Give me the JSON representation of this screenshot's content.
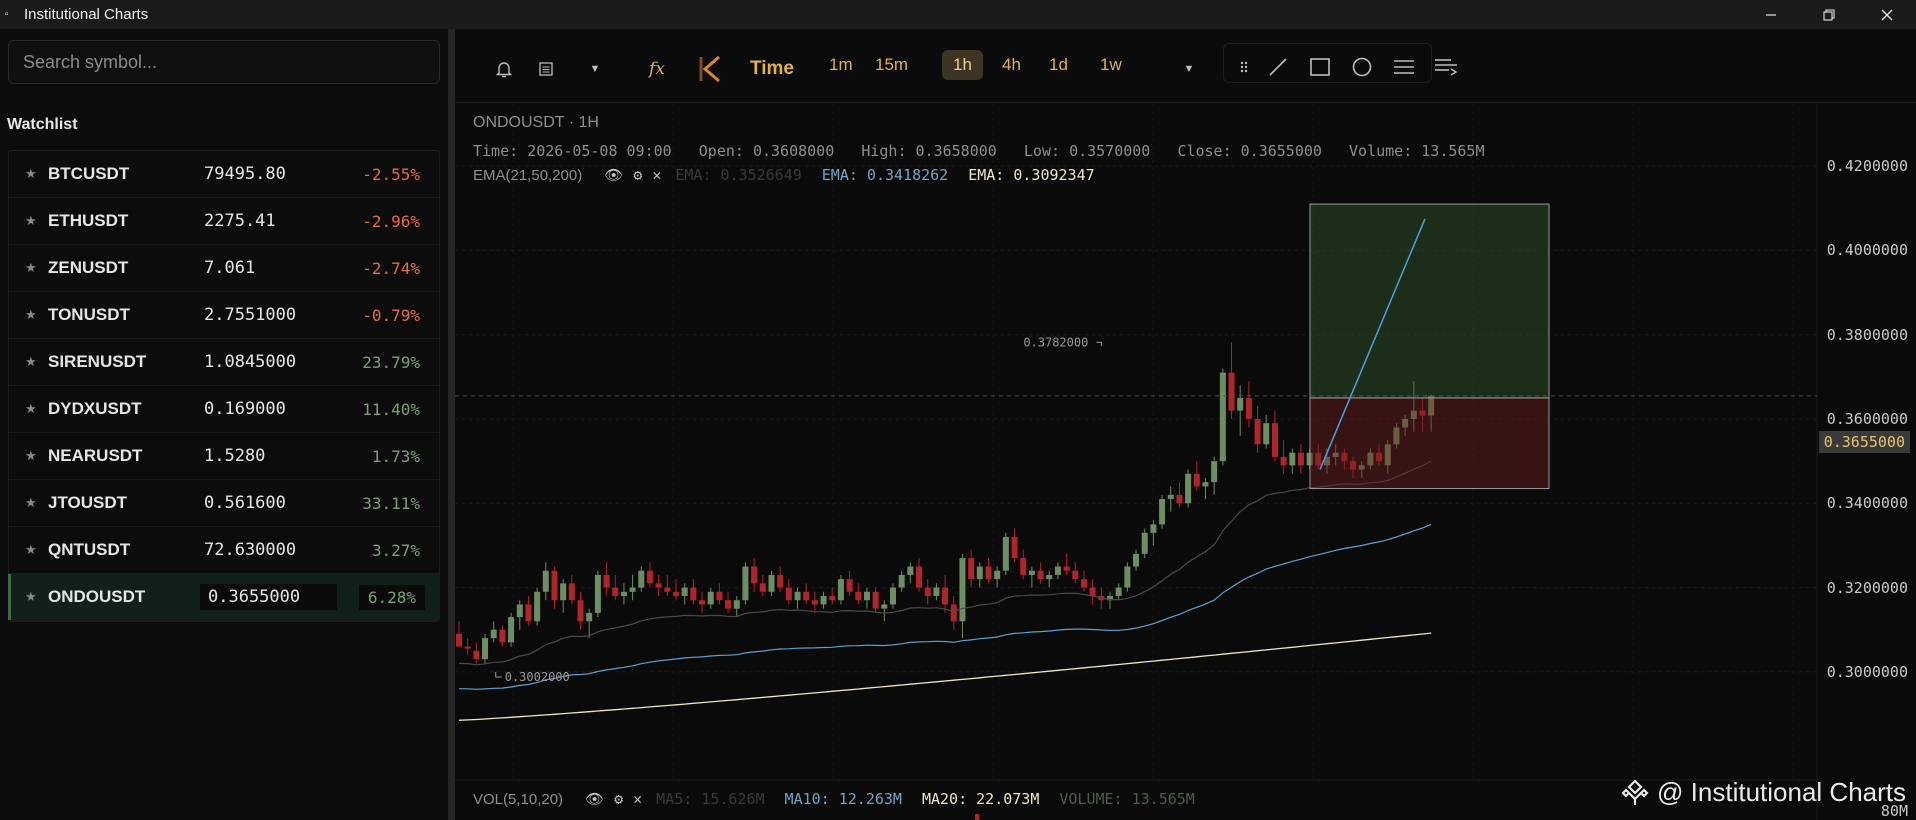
{
  "app": {
    "title": "Institutional Charts",
    "icon": "chart-app-icon",
    "window_controls": [
      "minimize-icon",
      "restore-icon",
      "close-icon"
    ]
  },
  "sidebar": {
    "search_placeholder": "Search symbol...",
    "watchlist_title": "Watchlist",
    "items": [
      {
        "symbol": "BTCUSDT",
        "price": "79495.80",
        "change": "-2.55%",
        "dir": "neg"
      },
      {
        "symbol": "ETHUSDT",
        "price": "2275.41",
        "change": "-2.96%",
        "dir": "neg"
      },
      {
        "symbol": "ZENUSDT",
        "price": "7.061",
        "change": "-2.74%",
        "dir": "neg"
      },
      {
        "symbol": "TONUSDT",
        "price": "2.7551000",
        "change": "-0.79%",
        "dir": "neg"
      },
      {
        "symbol": "SIRENUSDT",
        "price": "1.0845000",
        "change": "23.79%",
        "dir": "pos"
      },
      {
        "symbol": "DYDXUSDT",
        "price": "0.169000",
        "change": "11.40%",
        "dir": "pos"
      },
      {
        "symbol": "NEARUSDT",
        "price": "1.5280",
        "change": "1.73%",
        "dir": "pos"
      },
      {
        "symbol": "JTOUSDT",
        "price": "0.561600",
        "change": "33.11%",
        "dir": "pos"
      },
      {
        "symbol": "QNTUSDT",
        "price": "72.630000",
        "change": "3.27%",
        "dir": "pos"
      },
      {
        "symbol": "ONDOUSDT",
        "price": "0.3655000",
        "change": "6.28%",
        "dir": "pos",
        "active": true
      }
    ]
  },
  "toolbar": {
    "fx_label": "fx",
    "time_label": "Time",
    "timeframes": [
      "1m",
      "15m",
      "1h",
      "4h",
      "1d",
      "1w"
    ],
    "selected_timeframe": "1h",
    "tools": [
      "drag-handle-icon",
      "trend-line-icon",
      "rectangle-icon",
      "circle-icon",
      "parallel-lines-icon",
      "text-lines-icon"
    ]
  },
  "legend": {
    "title": "ONDOUSDT · 1H",
    "time_label": "Time:",
    "time": "2026-05-08 09:00",
    "open_label": "Open:",
    "open": "0.3608000",
    "high_label": "High:",
    "high": "0.3658000",
    "low_label": "Low:",
    "low": "0.3570000",
    "close_label": "Close:",
    "close": "0.3655000",
    "volume_label": "Volume:",
    "volume": "13.565M",
    "ema_title": "EMA(21,50,200)",
    "ema": [
      {
        "text": "EMA: 0.3526649",
        "color": "#3a3a3a"
      },
      {
        "text": "EMA: 0.3418262",
        "color": "#6fa5c8"
      },
      {
        "text": "EMA: 0.3092347",
        "color": "#efe6c6"
      }
    ],
    "vol_title": "VOL(5,10,20)",
    "vol": [
      {
        "text": "MA5: 15.626M",
        "color": "#3a3a3a"
      },
      {
        "text": "MA10: 12.263M",
        "color": "#6fa5c8"
      },
      {
        "text": "MA20: 22.073M",
        "color": "#efe6c6"
      },
      {
        "text": "VOLUME: 13.565M",
        "color": "#4a5e4a"
      }
    ]
  },
  "chart_data": {
    "type": "candlestick",
    "symbol": "ONDOUSDT",
    "interval": "1H",
    "ylim": [
      0.29,
      0.43
    ],
    "y_ticks": [
      "0.4200000",
      "0.4000000",
      "0.3800000",
      "0.3600000",
      "0.3400000",
      "0.3200000",
      "0.3000000"
    ],
    "current_price": "0.3655000",
    "annotations": {
      "high": "0.3782000",
      "low": "0.3002000"
    },
    "volume_axis_label": "80M",
    "colors": {
      "up": "#6b8f63",
      "down": "#b0242a",
      "ema21": "#4a4a4a",
      "ema50": "#5ea0cc",
      "ema200": "#efe6c6",
      "accent": "#e2b14a"
    },
    "candles": [
      [
        0.309,
        0.312,
        0.306,
        0.306
      ],
      [
        0.306,
        0.308,
        0.304,
        0.3055
      ],
      [
        0.305,
        0.307,
        0.302,
        0.303
      ],
      [
        0.303,
        0.309,
        0.302,
        0.308
      ],
      [
        0.308,
        0.312,
        0.307,
        0.31
      ],
      [
        0.31,
        0.311,
        0.306,
        0.307
      ],
      [
        0.307,
        0.314,
        0.306,
        0.313
      ],
      [
        0.313,
        0.317,
        0.31,
        0.316
      ],
      [
        0.316,
        0.318,
        0.311,
        0.312
      ],
      [
        0.312,
        0.32,
        0.311,
        0.319
      ],
      [
        0.319,
        0.326,
        0.317,
        0.324
      ],
      [
        0.324,
        0.325,
        0.315,
        0.317
      ],
      [
        0.317,
        0.322,
        0.314,
        0.321
      ],
      [
        0.321,
        0.323,
        0.316,
        0.317
      ],
      [
        0.317,
        0.319,
        0.31,
        0.312
      ],
      [
        0.312,
        0.315,
        0.308,
        0.314
      ],
      [
        0.314,
        0.324,
        0.313,
        0.323
      ],
      [
        0.323,
        0.326,
        0.318,
        0.32
      ],
      [
        0.32,
        0.323,
        0.317,
        0.318
      ],
      [
        0.318,
        0.321,
        0.316,
        0.319
      ],
      [
        0.319,
        0.323,
        0.317,
        0.32
      ],
      [
        0.32,
        0.325,
        0.319,
        0.324
      ],
      [
        0.324,
        0.326,
        0.32,
        0.321
      ],
      [
        0.321,
        0.323,
        0.318,
        0.32
      ],
      [
        0.32,
        0.323,
        0.318,
        0.319
      ],
      [
        0.319,
        0.322,
        0.317,
        0.318
      ],
      [
        0.318,
        0.321,
        0.316,
        0.32
      ],
      [
        0.32,
        0.322,
        0.316,
        0.317
      ],
      [
        0.317,
        0.319,
        0.314,
        0.316
      ],
      [
        0.316,
        0.32,
        0.315,
        0.319
      ],
      [
        0.319,
        0.321,
        0.316,
        0.317
      ],
      [
        0.317,
        0.319,
        0.314,
        0.315
      ],
      [
        0.315,
        0.318,
        0.313,
        0.317
      ],
      [
        0.317,
        0.326,
        0.316,
        0.325
      ],
      [
        0.325,
        0.327,
        0.319,
        0.321
      ],
      [
        0.321,
        0.323,
        0.318,
        0.319
      ],
      [
        0.319,
        0.324,
        0.318,
        0.323
      ],
      [
        0.323,
        0.325,
        0.319,
        0.32
      ],
      [
        0.32,
        0.322,
        0.316,
        0.317
      ],
      [
        0.317,
        0.32,
        0.315,
        0.319
      ],
      [
        0.319,
        0.321,
        0.316,
        0.317
      ],
      [
        0.317,
        0.319,
        0.314,
        0.316
      ],
      [
        0.316,
        0.319,
        0.315,
        0.318
      ],
      [
        0.318,
        0.32,
        0.316,
        0.317
      ],
      [
        0.317,
        0.323,
        0.316,
        0.322
      ],
      [
        0.322,
        0.324,
        0.318,
        0.319
      ],
      [
        0.319,
        0.321,
        0.316,
        0.317
      ],
      [
        0.317,
        0.32,
        0.315,
        0.319
      ],
      [
        0.319,
        0.32,
        0.314,
        0.315
      ],
      [
        0.315,
        0.317,
        0.312,
        0.316
      ],
      [
        0.316,
        0.321,
        0.315,
        0.32
      ],
      [
        0.32,
        0.324,
        0.319,
        0.323
      ],
      [
        0.323,
        0.326,
        0.321,
        0.325
      ],
      [
        0.325,
        0.327,
        0.319,
        0.32
      ],
      [
        0.32,
        0.322,
        0.316,
        0.318
      ],
      [
        0.318,
        0.321,
        0.317,
        0.32
      ],
      [
        0.32,
        0.323,
        0.314,
        0.316
      ],
      [
        0.316,
        0.318,
        0.31,
        0.312
      ],
      [
        0.312,
        0.328,
        0.308,
        0.327
      ],
      [
        0.327,
        0.329,
        0.32,
        0.322
      ],
      [
        0.322,
        0.326,
        0.32,
        0.325
      ],
      [
        0.325,
        0.327,
        0.321,
        0.322
      ],
      [
        0.322,
        0.325,
        0.32,
        0.324
      ],
      [
        0.324,
        0.333,
        0.323,
        0.332
      ],
      [
        0.332,
        0.334,
        0.326,
        0.327
      ],
      [
        0.327,
        0.329,
        0.322,
        0.323
      ],
      [
        0.323,
        0.325,
        0.32,
        0.324
      ],
      [
        0.324,
        0.326,
        0.321,
        0.322
      ],
      [
        0.322,
        0.324,
        0.32,
        0.323
      ],
      [
        0.323,
        0.326,
        0.322,
        0.325
      ],
      [
        0.325,
        0.328,
        0.323,
        0.324
      ],
      [
        0.324,
        0.326,
        0.321,
        0.322
      ],
      [
        0.322,
        0.324,
        0.319,
        0.32
      ],
      [
        0.32,
        0.322,
        0.316,
        0.318
      ],
      [
        0.318,
        0.32,
        0.315,
        0.317
      ],
      [
        0.317,
        0.319,
        0.315,
        0.318
      ],
      [
        0.318,
        0.321,
        0.317,
        0.32
      ],
      [
        0.32,
        0.326,
        0.319,
        0.325
      ],
      [
        0.325,
        0.329,
        0.324,
        0.328
      ],
      [
        0.328,
        0.334,
        0.327,
        0.333
      ],
      [
        0.333,
        0.336,
        0.33,
        0.335
      ],
      [
        0.335,
        0.342,
        0.334,
        0.341
      ],
      [
        0.341,
        0.344,
        0.338,
        0.342
      ],
      [
        0.342,
        0.345,
        0.339,
        0.34
      ],
      [
        0.34,
        0.348,
        0.339,
        0.347
      ],
      [
        0.347,
        0.35,
        0.343,
        0.344
      ],
      [
        0.344,
        0.346,
        0.341,
        0.345
      ],
      [
        0.345,
        0.351,
        0.342,
        0.35
      ],
      [
        0.35,
        0.372,
        0.349,
        0.371
      ],
      [
        0.371,
        0.3782,
        0.36,
        0.362
      ],
      [
        0.362,
        0.368,
        0.356,
        0.365
      ],
      [
        0.365,
        0.369,
        0.358,
        0.36
      ],
      [
        0.36,
        0.363,
        0.352,
        0.354
      ],
      [
        0.354,
        0.361,
        0.353,
        0.359
      ],
      [
        0.359,
        0.362,
        0.35,
        0.351
      ],
      [
        0.351,
        0.355,
        0.347,
        0.349
      ],
      [
        0.349,
        0.353,
        0.347,
        0.352
      ],
      [
        0.352,
        0.354,
        0.347,
        0.349
      ],
      [
        0.349,
        0.353,
        0.348,
        0.352
      ],
      [
        0.352,
        0.354,
        0.348,
        0.349
      ],
      [
        0.349,
        0.353,
        0.347,
        0.351
      ],
      [
        0.351,
        0.354,
        0.349,
        0.352
      ],
      [
        0.352,
        0.353,
        0.348,
        0.35
      ],
      [
        0.35,
        0.351,
        0.346,
        0.348
      ],
      [
        0.348,
        0.35,
        0.346,
        0.349
      ],
      [
        0.349,
        0.353,
        0.348,
        0.352
      ],
      [
        0.352,
        0.354,
        0.349,
        0.35
      ],
      [
        0.349,
        0.355,
        0.347,
        0.354
      ],
      [
        0.354,
        0.359,
        0.353,
        0.358
      ],
      [
        0.358,
        0.361,
        0.356,
        0.36
      ],
      [
        0.36,
        0.369,
        0.357,
        0.362
      ],
      [
        0.362,
        0.365,
        0.357,
        0.3608
      ],
      [
        0.3608,
        0.3658,
        0.357,
        0.3655
      ]
    ],
    "position_tool": {
      "entry": 0.365,
      "target": 0.411,
      "stop": 0.3435
    }
  }
}
